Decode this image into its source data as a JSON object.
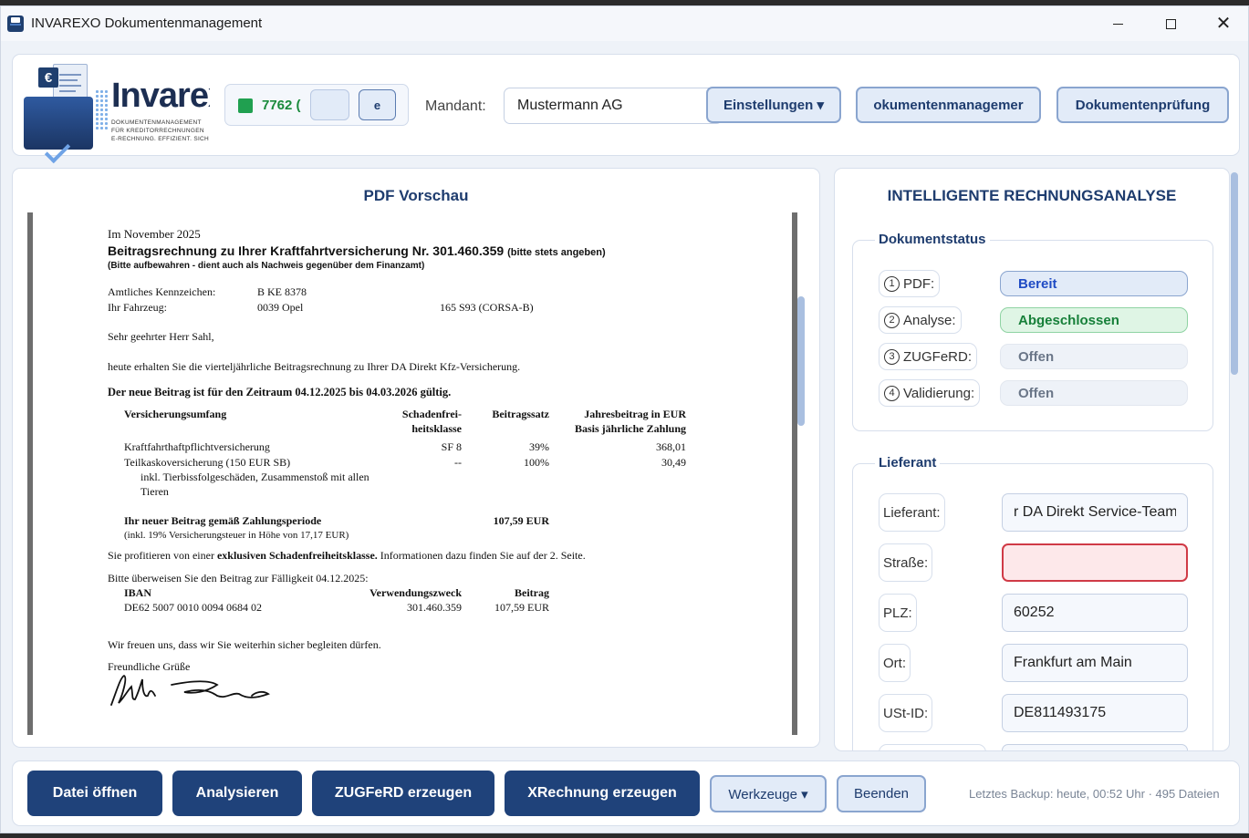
{
  "window": {
    "title": "INVAREXO Dokumentenmanagement"
  },
  "header": {
    "logo_text": "Invarex",
    "logo_tagline": [
      "DOKUMENTENMANAGEMENT",
      "FÜR KREDITORRECHNUNGEN",
      "E-RECHNUNG. EFFIZIENT. SICH"
    ],
    "logo_euro": "€",
    "license_number": "7762 (",
    "license_button_label": "e",
    "mandant_label": "Mandant:",
    "mandant_value": "Mustermann AG",
    "settings_button": "Einstellungen ▾",
    "docmgmt_button": "okumentenmanagemer",
    "docreview_button": "Dokumentenprüfung"
  },
  "pdf_preview": {
    "title": "PDF Vorschau",
    "document": {
      "date_line": "Im November 2025",
      "heading": "Beitragsrechnung zu Ihrer Kraftfahrtversicherung Nr. 301.460.359",
      "heading_note": "(bitte stets angeben)",
      "subheading": "(Bitte aufbewahren - dient auch als Nachweis gegenüber dem Finanzamt)",
      "plate_label": "Amtliches Kennzeichen:",
      "plate_value": "B KE 8378",
      "vehicle_label": "Ihr Fahrzeug:",
      "vehicle_value": "0039 Opel",
      "vehicle_model": "165 S93 (CORSA-B)",
      "greeting": "Sehr geehrter Herr Sahl,",
      "intro": "heute erhalten Sie die vierteljährliche Beitragsrechnung zu Ihrer DA Direkt Kfz-Versicherung.",
      "period_line": "Der neue Beitrag ist für den Zeitraum 04.12.2025 bis 04.03.2026 gültig.",
      "table_headers": {
        "scope": "Versicherungsumfang",
        "sf_class_1": "Schadenfrei-",
        "sf_class_2": "heitsklasse",
        "rate": "Beitragssatz",
        "annual_1": "Jahresbeitrag in EUR",
        "annual_2": "Basis jährliche Zahlung"
      },
      "rows": [
        {
          "scope": "Kraftfahrthaftpflichtversicherung",
          "sf": "SF 8",
          "rate": "39%",
          "annual": "368,01"
        },
        {
          "scope": "Teilkaskoversicherung (150 EUR SB)",
          "sf": "--",
          "rate": "100%",
          "annual": "30,49"
        }
      ],
      "row2_note_1": "inkl. Tierbissfolgeschäden, Zusammenstoß mit allen",
      "row2_note_2": "Tieren",
      "new_premium_label": "Ihr neuer Beitrag gemäß Zahlungsperiode",
      "new_premium_value": "107,59 EUR",
      "tax_note": "(inkl. 19% Versicherungsteuer in Höhe von 17,17 EUR)",
      "benefit_pre": "Sie profitieren von einer ",
      "benefit_bold": "exklusiven Schadenfreiheitsklasse.",
      "benefit_post": " Informationen dazu finden Sie auf der 2. Seite.",
      "transfer_line": "Bitte überweisen Sie den Beitrag zur Fälligkeit 04.12.2025:",
      "pay_headers": {
        "iban": "IBAN",
        "purpose": "Verwendungszweck",
        "amount": "Beitrag"
      },
      "pay_values": {
        "iban": "DE62 5007 0010 0094 0684 02",
        "purpose": "301.460.359",
        "amount": "107,59 EUR"
      },
      "closing": "Wir freuen uns, dass wir Sie weiterhin sicher begleiten dürfen.",
      "regards": "Freundliche Grüße"
    }
  },
  "analysis": {
    "title": "INTELLIGENTE RECHNUNGSANALYSE",
    "status_group_title": "Dokumentstatus",
    "statuses": [
      {
        "num": "1",
        "label": "PDF:",
        "value": "Bereit"
      },
      {
        "num": "2",
        "label": "Analyse:",
        "value": "Abgeschlossen"
      },
      {
        "num": "3",
        "label": "ZUGFeRD:",
        "value": "Offen"
      },
      {
        "num": "4",
        "label": "Validierung:",
        "value": "Offen"
      }
    ],
    "supplier_group_title": "Lieferant",
    "fields": [
      {
        "label": "Lieferant:",
        "value": "r DA Direkt Service-Team"
      },
      {
        "label": "Straße:",
        "value": ""
      },
      {
        "label": "PLZ:",
        "value": "60252"
      },
      {
        "label": "Ort:",
        "value": "Frankfurt am Main"
      },
      {
        "label": "USt-ID:",
        "value": "DE811493175"
      }
    ]
  },
  "footer": {
    "open_file": "Datei öffnen",
    "analyze": "Analysieren",
    "zugferd": "ZUGFeRD erzeugen",
    "xrechnung": "XRechnung erzeugen",
    "tools": "Werkzeuge ▾",
    "quit": "Beenden",
    "backup_status": "Letztes Backup: heute, 00:52 Uhr · 495 Dateien"
  },
  "colors": {
    "primary": "#1f427a",
    "accent": "#1e3c6e",
    "success": "#17803a",
    "error": "#d03a46"
  }
}
